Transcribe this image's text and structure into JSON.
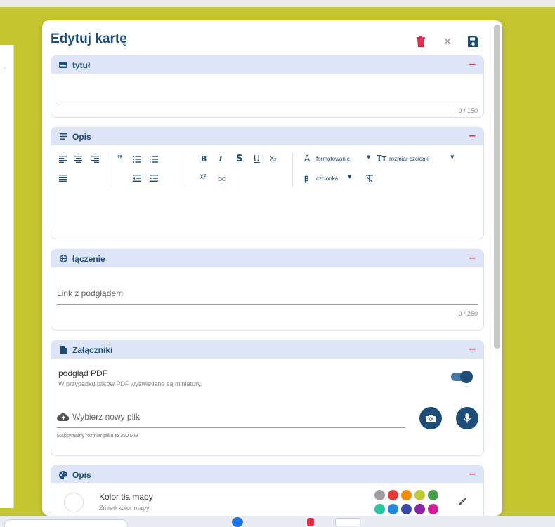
{
  "dialog": {
    "title": "Edytuj kartę",
    "close_glyph": "×"
  },
  "sections": {
    "title_section": {
      "label": "tytuł",
      "counter": "0 / 150",
      "icon": "card-icon"
    },
    "description": {
      "label": "Opis",
      "icon": "lines-icon",
      "toolbar": {
        "bold": "B",
        "italic": "I",
        "strike": "S",
        "underline": "U",
        "subscript": "X₂",
        "superscript": "X²",
        "formatting": "formatowanie",
        "font_size": "rozmiar czcionki",
        "font": "czcionka",
        "formatting_icon_glyph": "A",
        "font_size_icon_glyph": "Tт"
      }
    },
    "link": {
      "label": "łączenie",
      "placeholder": "Link z podglądem",
      "counter": "0 / 250",
      "icon": "globe-icon"
    },
    "attachments": {
      "label": "Załączniki",
      "icon": "file-icon",
      "pdf_title": "podgląd PDF",
      "pdf_desc": "W przypadku plików PDF wyświetlane są miniatury.",
      "pdf_toggle_on": true,
      "choose_file": "Wybierz nowy plik",
      "max_size": "Maksymalny rozmiar pliku to 250 MiB"
    },
    "style": {
      "label": "Opis",
      "icon": "palette-icon",
      "bg_title": "Kolor tła mapy",
      "bg_desc": "Zmień kolor mapy.",
      "swatches_row1": [
        "#9e9e9e",
        "#e53935",
        "#fb8c00",
        "#c0ca33",
        "#43a047"
      ],
      "swatches_row2": [
        "#26c6a0",
        "#1e88e5",
        "#3949ab",
        "#8e24aa",
        "#d81b9c"
      ]
    }
  },
  "colors": {
    "accent": "#1e4d78",
    "danger": "#e4304a",
    "page_bg": "#c5c62f",
    "section_header": "#dde5f6"
  }
}
